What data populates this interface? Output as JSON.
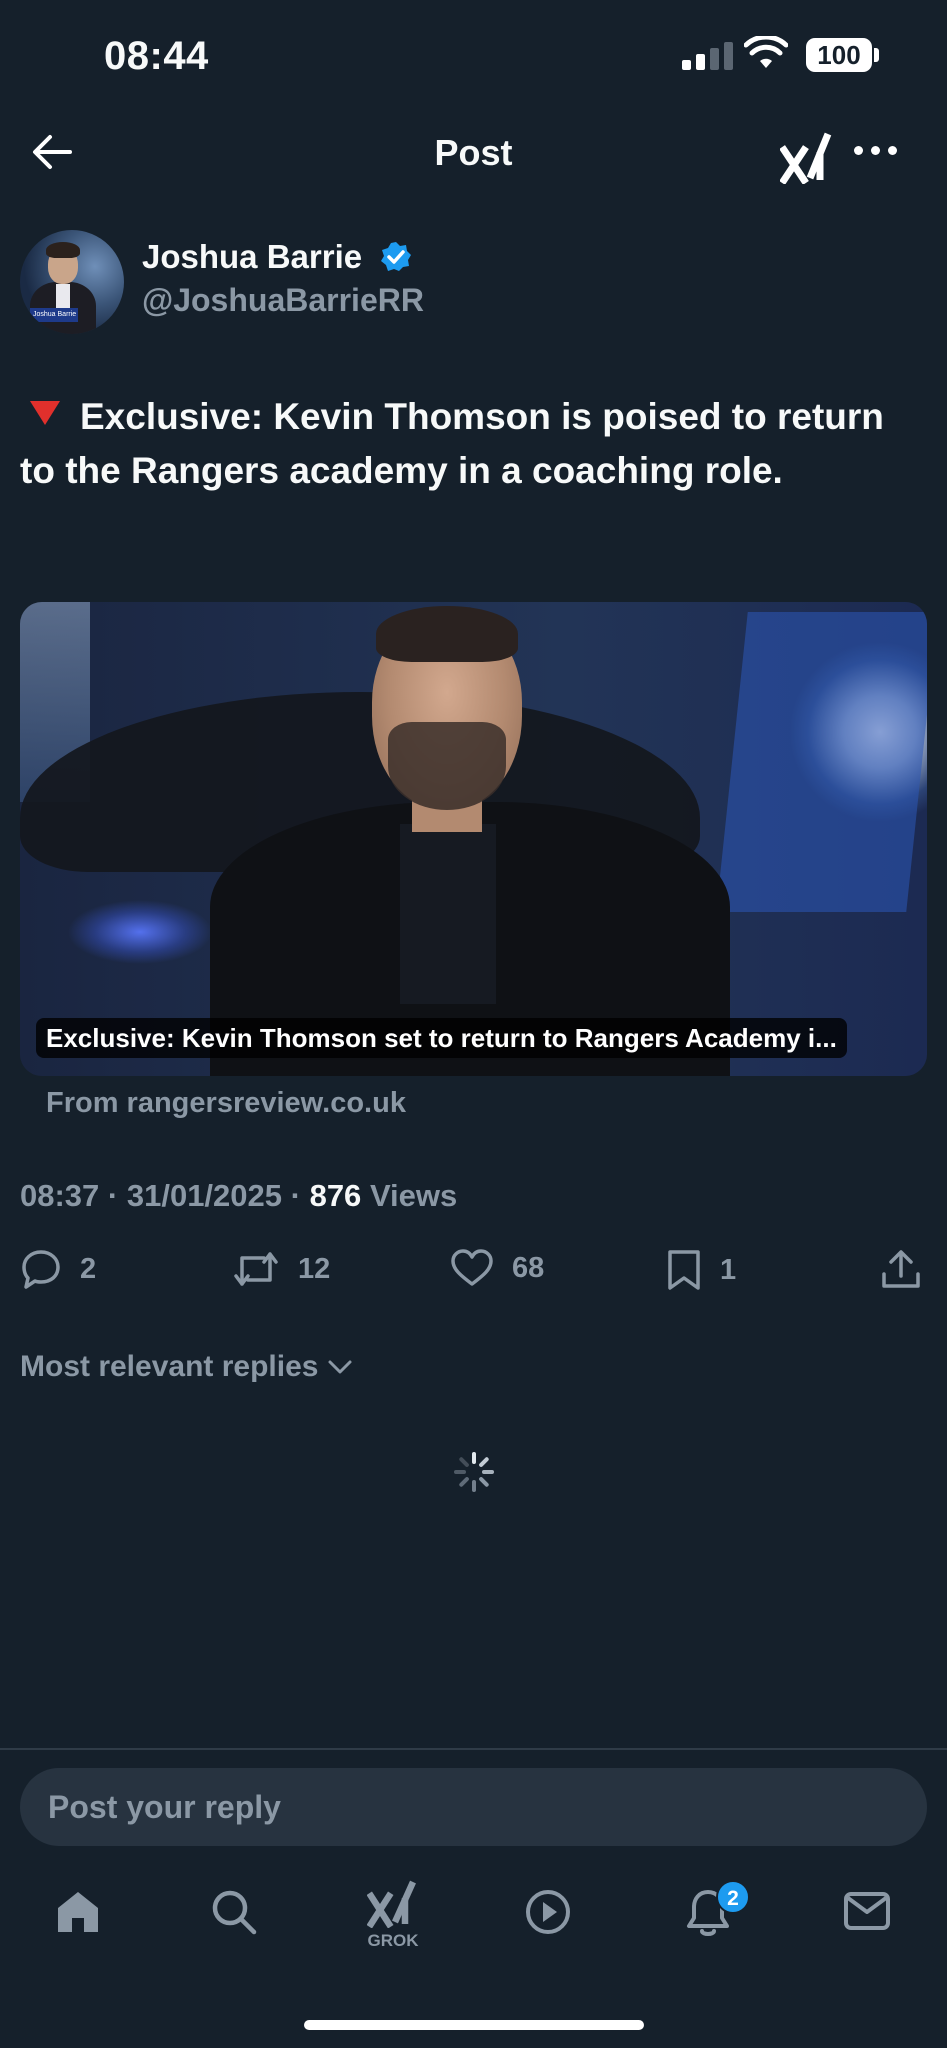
{
  "status_bar": {
    "time": "08:44",
    "battery": "100"
  },
  "header": {
    "title": "Post"
  },
  "author": {
    "name": "Joshua Barrie",
    "handle": "@JoshuaBarrieRR",
    "avatar_tag": "Joshua Barrie"
  },
  "post": {
    "text": "Exclusive: Kevin Thomson is poised to return to the Rangers academy in a coaching role.",
    "link_card": {
      "caption": "Exclusive: Kevin Thomson set to return to Rangers Academy i...",
      "source": "From rangersreview.co.uk"
    },
    "time": "08:37",
    "date": "31/01/2025",
    "views_count": "876",
    "views_label": "Views"
  },
  "actions": {
    "replies": "2",
    "reposts": "12",
    "likes": "68",
    "bookmarks": "1"
  },
  "replies_sort": {
    "label": "Most relevant replies"
  },
  "reply_input": {
    "placeholder": "Post your reply"
  },
  "tab_bar": {
    "grok_label": "GROK",
    "notifications_badge": "2"
  },
  "colors": {
    "background": "#15202b",
    "text_primary": "#f7f9f9",
    "text_secondary": "#8b98a5",
    "accent": "#1d9bf0",
    "alert_red": "#e0302c"
  },
  "icons": [
    "back-arrow-icon",
    "grok-icon",
    "more-icon",
    "verified-icon",
    "reply-icon",
    "repost-icon",
    "like-icon",
    "bookmark-icon",
    "share-icon",
    "chevron-down-icon",
    "loading-spinner-icon",
    "home-icon",
    "search-icon",
    "play-icon",
    "bell-icon",
    "mail-icon"
  ]
}
